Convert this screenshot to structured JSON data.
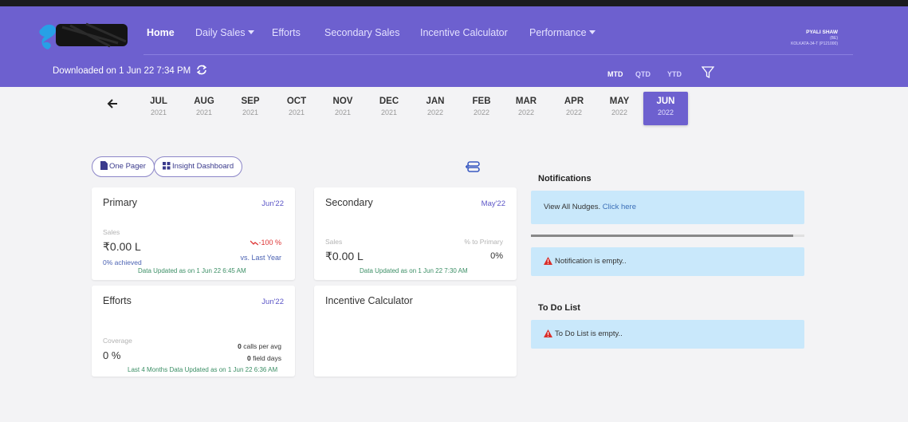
{
  "header": {
    "nav": [
      {
        "label": "Home",
        "active": true,
        "dropdown": false
      },
      {
        "label": "Daily Sales",
        "active": false,
        "dropdown": true
      },
      {
        "label": "Efforts",
        "active": false,
        "dropdown": false
      },
      {
        "label": "Secondary Sales",
        "active": false,
        "dropdown": false
      },
      {
        "label": "Incentive Calculator",
        "active": false,
        "dropdown": false
      },
      {
        "label": "Performance",
        "active": false,
        "dropdown": true
      }
    ],
    "user": {
      "name": "PYALI SHAW",
      "role": "(BE)",
      "location": "KOLKATA-34-T (P121000)"
    },
    "downloaded": "Downloaded on 1 Jun 22 7:34 PM",
    "periods": [
      {
        "label": "MTD",
        "active": true
      },
      {
        "label": "QTD",
        "active": false
      },
      {
        "label": "YTD",
        "active": false
      }
    ]
  },
  "months": [
    {
      "m": "JUL",
      "y": "2021"
    },
    {
      "m": "AUG",
      "y": "2021"
    },
    {
      "m": "SEP",
      "y": "2021"
    },
    {
      "m": "OCT",
      "y": "2021"
    },
    {
      "m": "NOV",
      "y": "2021"
    },
    {
      "m": "DEC",
      "y": "2021"
    },
    {
      "m": "JAN",
      "y": "2022"
    },
    {
      "m": "FEB",
      "y": "2022"
    },
    {
      "m": "MAR",
      "y": "2022"
    },
    {
      "m": "APR",
      "y": "2022"
    },
    {
      "m": "MAY",
      "y": "2022"
    },
    {
      "m": "JUN",
      "y": "2022",
      "active": true
    }
  ],
  "buttons": {
    "one_pager": "One Pager",
    "insight": "Insight Dashboard"
  },
  "primary": {
    "title": "Primary",
    "date": "Jun'22",
    "sales_label": "Sales",
    "value": "₹0.00 L",
    "change": "-100 %",
    "vs": "vs. Last Year",
    "achieved": "0% achieved",
    "updated": "Data Updated as on 1 Jun 22 6:45 AM"
  },
  "secondary": {
    "title": "Secondary",
    "date": "May'22",
    "sales_label": "Sales",
    "value": "₹0.00 L",
    "pct_label": "% to Primary",
    "pct": "0%",
    "updated": "Data Updated as on 1 Jun 22 7:30 AM"
  },
  "efforts": {
    "title": "Efforts",
    "date": "Jun'22",
    "coverage_label": "Coverage",
    "coverage": "0 %",
    "calls_value": "0",
    "calls_text": "calls per avg",
    "days_value": "0",
    "days_text": "field days",
    "updated": "Last 4 Months Data Updated as on 1 Jun 22 6:36 AM"
  },
  "incentive": {
    "title": "Incentive Calculator"
  },
  "notifications": {
    "title": "Notifications",
    "nudges_text": "View All Nudges.",
    "nudges_link": "Click here",
    "progress": 0.96,
    "empty": "Notification is empty.."
  },
  "todo": {
    "title": "To Do List",
    "empty": "To Do List is empty.."
  },
  "colors": {
    "brand": "#6d60cf",
    "alert_bg": "#c9e8fb",
    "warning": "#d9302c"
  }
}
